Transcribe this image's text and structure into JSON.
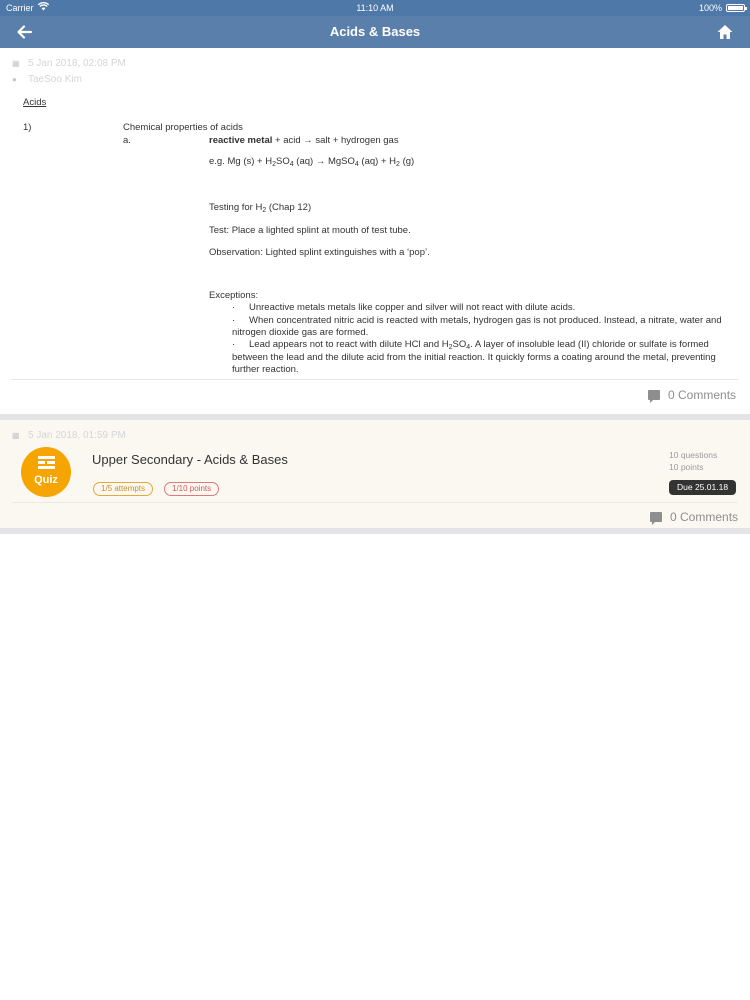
{
  "status_bar": {
    "carrier": "Carrier",
    "time": "11:10 AM",
    "battery": "100%"
  },
  "nav": {
    "title": "Acids & Bases",
    "back_icon": "arrow-left-icon",
    "home_icon": "home-icon"
  },
  "post": {
    "date": "5 Jan 2018, 02:08 PM",
    "author": "TaeSoo Kim",
    "heading": "Acids",
    "item_number": "1)",
    "item_title": "Chemical properties of acids",
    "sub_letter": "a.",
    "line1_bold": "reactive metal",
    "line1_rest": " + acid → salt + hydrogen gas",
    "eg_prefix": "e.g. Mg (s) + H",
    "eg_sub1": "2",
    "eg_mid1": "SO",
    "eg_sub2": "4",
    "eg_mid2": " (aq) → MgSO",
    "eg_sub3": "4",
    "eg_mid3": " (aq) + H",
    "eg_sub4": "2",
    "eg_end": " (g)",
    "testing_prefix": "Testing for H",
    "testing_sub": "2",
    "testing_end": " (Chap 12)",
    "test": "Test: Place a lighted splint at mouth of test tube.",
    "observation": "Observation: Lighted splint extinguishes with a ‘pop’.",
    "exceptions_heading": "Exceptions:",
    "bullet": "·",
    "exception1": "Unreactive metals metals like copper and silver will not react with dilute acids.",
    "exception2_line1": "When concentrated nitric acid is reacted with metals, hydrogen gas is not produced. Instead, a nitrate, water and",
    "exception2_line2": "nitrogen dioxide gas are formed.",
    "exception3_line1_a": "Lead appears not to react with dilute HCl and H",
    "exception3_sub1": "2",
    "exception3_line1_b": "SO",
    "exception3_sub2": "4",
    "exception3_line1_c": ". A layer of insoluble lead (II) chloride or sulfate is formed",
    "exception3_line2": "between the lead and the dilute acid from the initial reaction. It quickly forms a coating around the metal, preventing",
    "exception3_line3": "further reaction.",
    "comments": "0 Comments"
  },
  "quiz": {
    "date": "5 Jan 2018, 01:59 PM",
    "badge_label": "Quiz",
    "title": "Upper Secondary - Acids & Bases",
    "attempts": "1/5 attempts",
    "points_scored": "1/10 points",
    "questions": "10 questions",
    "points_total": "10 points",
    "due": "Due 25.01.18",
    "comments": "0 Comments"
  }
}
